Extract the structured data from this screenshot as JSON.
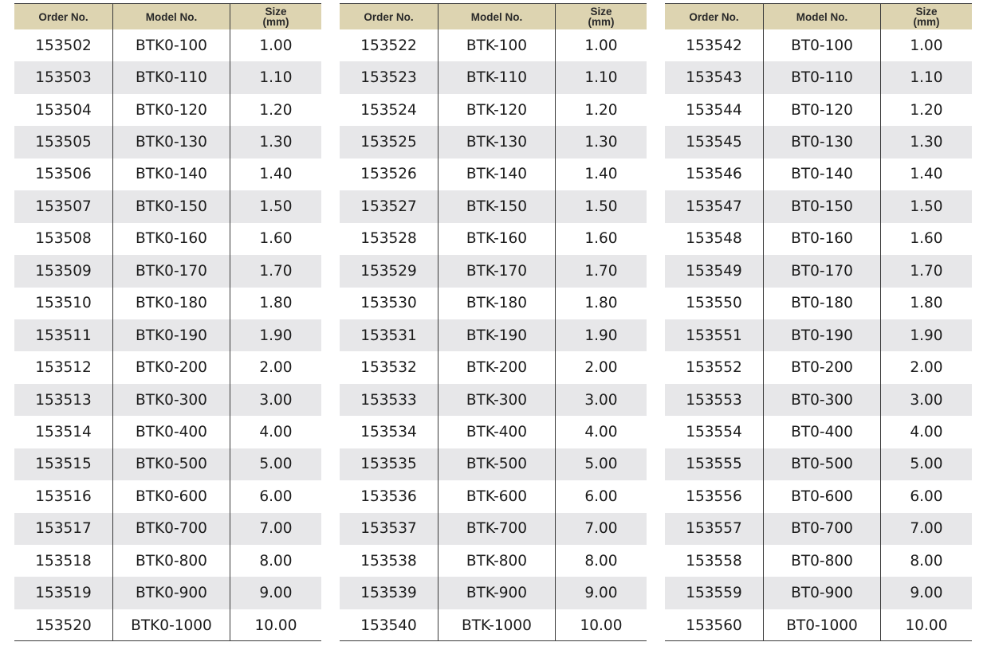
{
  "headers": {
    "order_no": "Order No.",
    "model_no": "Model No.",
    "size_line1": "Size",
    "size_line2": "(mm)"
  },
  "tables": [
    {
      "rows": [
        [
          "153502",
          "BTK0-100",
          "1.00"
        ],
        [
          "153503",
          "BTK0-110",
          "1.10"
        ],
        [
          "153504",
          "BTK0-120",
          "1.20"
        ],
        [
          "153505",
          "BTK0-130",
          "1.30"
        ],
        [
          "153506",
          "BTK0-140",
          "1.40"
        ],
        [
          "153507",
          "BTK0-150",
          "1.50"
        ],
        [
          "153508",
          "BTK0-160",
          "1.60"
        ],
        [
          "153509",
          "BTK0-170",
          "1.70"
        ],
        [
          "153510",
          "BTK0-180",
          "1.80"
        ],
        [
          "153511",
          "BTK0-190",
          "1.90"
        ],
        [
          "153512",
          "BTK0-200",
          "2.00"
        ],
        [
          "153513",
          "BTK0-300",
          "3.00"
        ],
        [
          "153514",
          "BTK0-400",
          "4.00"
        ],
        [
          "153515",
          "BTK0-500",
          "5.00"
        ],
        [
          "153516",
          "BTK0-600",
          "6.00"
        ],
        [
          "153517",
          "BTK0-700",
          "7.00"
        ],
        [
          "153518",
          "BTK0-800",
          "8.00"
        ],
        [
          "153519",
          "BTK0-900",
          "9.00"
        ],
        [
          "153520",
          "BTK0-1000",
          "10.00"
        ]
      ]
    },
    {
      "rows": [
        [
          "153522",
          "BTK-100",
          "1.00"
        ],
        [
          "153523",
          "BTK-110",
          "1.10"
        ],
        [
          "153524",
          "BTK-120",
          "1.20"
        ],
        [
          "153525",
          "BTK-130",
          "1.30"
        ],
        [
          "153526",
          "BTK-140",
          "1.40"
        ],
        [
          "153527",
          "BTK-150",
          "1.50"
        ],
        [
          "153528",
          "BTK-160",
          "1.60"
        ],
        [
          "153529",
          "BTK-170",
          "1.70"
        ],
        [
          "153530",
          "BTK-180",
          "1.80"
        ],
        [
          "153531",
          "BTK-190",
          "1.90"
        ],
        [
          "153532",
          "BTK-200",
          "2.00"
        ],
        [
          "153533",
          "BTK-300",
          "3.00"
        ],
        [
          "153534",
          "BTK-400",
          "4.00"
        ],
        [
          "153535",
          "BTK-500",
          "5.00"
        ],
        [
          "153536",
          "BTK-600",
          "6.00"
        ],
        [
          "153537",
          "BTK-700",
          "7.00"
        ],
        [
          "153538",
          "BTK-800",
          "8.00"
        ],
        [
          "153539",
          "BTK-900",
          "9.00"
        ],
        [
          "153540",
          "BTK-1000",
          "10.00"
        ]
      ]
    },
    {
      "rows": [
        [
          "153542",
          "BT0-100",
          "1.00"
        ],
        [
          "153543",
          "BT0-110",
          "1.10"
        ],
        [
          "153544",
          "BT0-120",
          "1.20"
        ],
        [
          "153545",
          "BT0-130",
          "1.30"
        ],
        [
          "153546",
          "BT0-140",
          "1.40"
        ],
        [
          "153547",
          "BT0-150",
          "1.50"
        ],
        [
          "153548",
          "BT0-160",
          "1.60"
        ],
        [
          "153549",
          "BT0-170",
          "1.70"
        ],
        [
          "153550",
          "BT0-180",
          "1.80"
        ],
        [
          "153551",
          "BT0-190",
          "1.90"
        ],
        [
          "153552",
          "BT0-200",
          "2.00"
        ],
        [
          "153553",
          "BT0-300",
          "3.00"
        ],
        [
          "153554",
          "BT0-400",
          "4.00"
        ],
        [
          "153555",
          "BT0-500",
          "5.00"
        ],
        [
          "153556",
          "BT0-600",
          "6.00"
        ],
        [
          "153557",
          "BT0-700",
          "7.00"
        ],
        [
          "153558",
          "BT0-800",
          "8.00"
        ],
        [
          "153559",
          "BT0-900",
          "9.00"
        ],
        [
          "153560",
          "BT0-1000",
          "10.00"
        ]
      ]
    }
  ]
}
